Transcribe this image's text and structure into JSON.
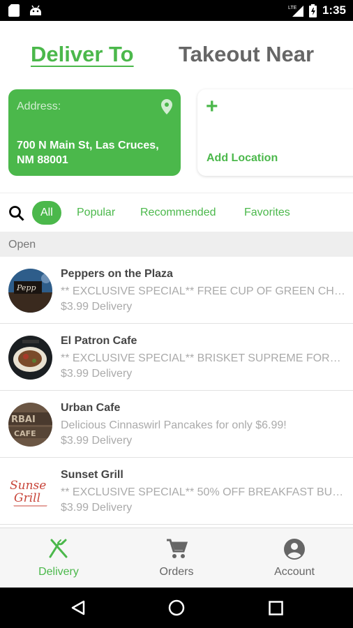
{
  "status_bar": {
    "time": "1:35",
    "network": "LTE"
  },
  "header": {
    "deliver_tab": "Deliver To",
    "takeout_tab": "Takeout Near"
  },
  "address_card": {
    "label": "Address:",
    "address": "700 N Main St, Las Cruces, NM 88001"
  },
  "add_location": {
    "plus": "+",
    "label": "Add Location"
  },
  "filters": [
    "All",
    "Popular",
    "Recommended",
    "Favorites"
  ],
  "section": {
    "title": "Open"
  },
  "restaurants": [
    {
      "name": "Peppers on the Plaza",
      "desc": "** EXCLUSIVE SPECIAL**  FREE CUP OF GREEN CHI…",
      "fee": "$3.99 Delivery"
    },
    {
      "name": "El Patron Cafe",
      "desc": "** EXCLUSIVE SPECIAL** BRISKET SUPREME FOR…",
      "fee": "$3.99 Delivery"
    },
    {
      "name": "Urban Cafe",
      "desc": "Delicious Cinnaswirl Pancakes for only $6.99!",
      "fee": "$3.99 Delivery"
    },
    {
      "name": "Sunset Grill",
      "desc": "** EXCLUSIVE SPECIAL** 50% OFF BREAKFAST BU…",
      "fee": "$3.99 Delivery"
    }
  ],
  "bottom_nav": {
    "delivery": "Delivery",
    "orders": "Orders",
    "account": "Account"
  },
  "colors": {
    "accent": "#4bb84b",
    "section_bg": "#eeeeee"
  }
}
